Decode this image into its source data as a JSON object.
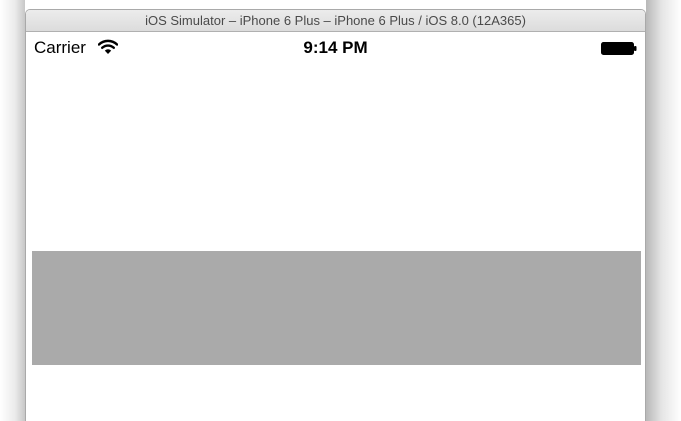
{
  "window": {
    "title": "iOS Simulator – iPhone 6 Plus – iPhone 6 Plus / iOS 8.0 (12A365)"
  },
  "status_bar": {
    "carrier": "Carrier",
    "time": "9:14 PM",
    "icons": [
      "wifi-icon",
      "battery-icon"
    ]
  },
  "content": {
    "view_color": "#aaaaaa"
  }
}
